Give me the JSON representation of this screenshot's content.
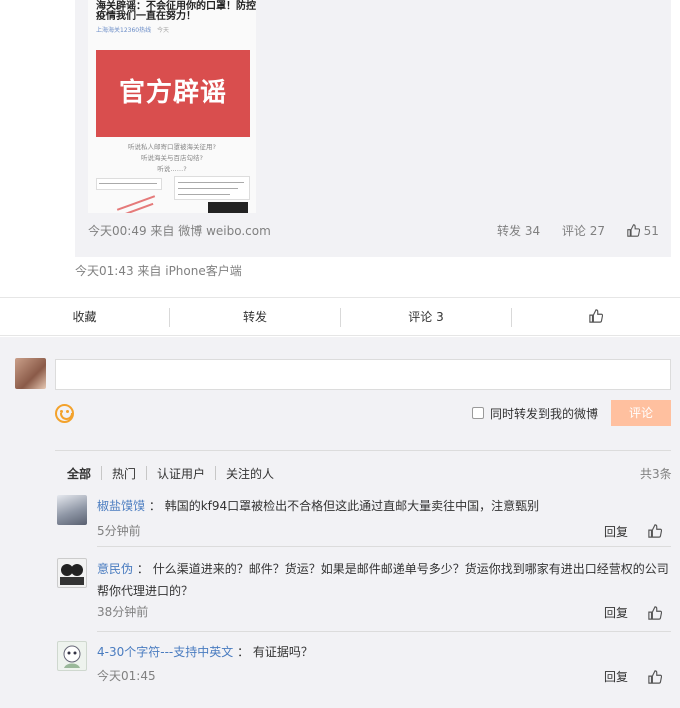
{
  "repost": {
    "thumb_line1": "海关辟谣：不会征用你的口罩！防控",
    "thumb_line2": "疫情我们一直在努力！",
    "thumb_meta": "上海海关12360热线",
    "thumb_meta_time": "今天",
    "banner_text": "官方辟谣",
    "thumb_q1": "听说私人邮寄口罩被海关征用?",
    "thumb_q2": "听说海关与百店勾结?",
    "thumb_q3": "听说……?",
    "meta_time": "今天00:49",
    "meta_from": "来自",
    "meta_source": "微博 weibo.com",
    "forward_label": "转发 34",
    "comment_label": "评论 27",
    "like_count": "51"
  },
  "post_meta": {
    "time": "今天01:43",
    "from": "来自 iPhone客户端"
  },
  "action_bar": {
    "collect": "收藏",
    "forward": "转发",
    "comment": "评论 3"
  },
  "composer": {
    "placeholder": "",
    "repost_check_label": "同时转发到我的微博",
    "submit_label": "评论"
  },
  "filters": {
    "all": "全部",
    "hot": "热门",
    "verified": "认证用户",
    "following": "关注的人",
    "total": "共3条"
  },
  "comments": [
    {
      "user": "椒盐馍馍",
      "sep": "：",
      "text": "韩国的kf94口罩被检出不合格但这此通过直邮大量卖往中国，注意甄别",
      "time": "5分钟前",
      "reply": "回复"
    },
    {
      "user": "意民伪",
      "sep": "：",
      "text": "什么渠道进来的？邮件？货运？如果是邮件邮递单号多少？货运你找到哪家有进出口经营权的公司帮你代理进口的？",
      "time": "38分钟前",
      "reply": "回复"
    },
    {
      "user": "4-30个字符---支持中英文",
      "sep": "：",
      "text": "有证据吗？",
      "time": "今天01:45",
      "reply": "回复"
    }
  ],
  "colors": {
    "link_blue": "#4a7cc0",
    "button_disabled": "#ffc09f",
    "emoji_orange": "#f3a22c",
    "banner_red": "#d94e4e"
  }
}
